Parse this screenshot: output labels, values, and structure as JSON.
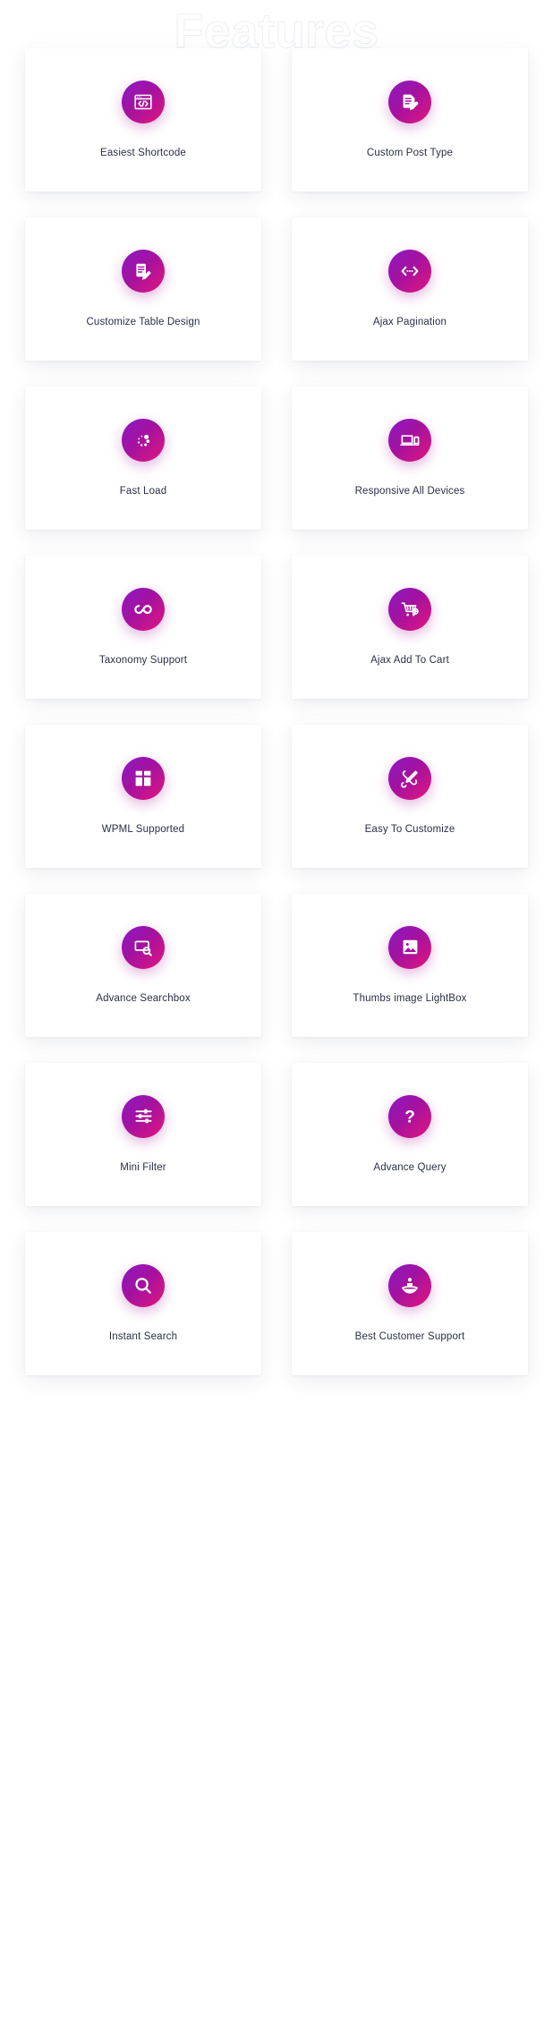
{
  "section": {
    "title": "Features",
    "title_style": "outlined-ghost",
    "outline_color": "#eceef1"
  },
  "theme": {
    "page_background": "#ffffff",
    "card_background": "#ffffff",
    "label_color": "#2b2f45",
    "icon_gradient_start": "#8b18c4",
    "icon_gradient_mid": "#a3129f",
    "icon_gradient_end": "#e3157e"
  },
  "cards": [
    {
      "label": "Easiest Shortcode",
      "icon": "code-window-icon"
    },
    {
      "label": "Custom Post Type",
      "icon": "document-pencil-icon"
    },
    {
      "label": "Customize Table Design",
      "icon": "table-edit-icon"
    },
    {
      "label": "Ajax Pagination",
      "icon": "pagination-arrows-icon"
    },
    {
      "label": "Fast Load",
      "icon": "spinner-dots-icon"
    },
    {
      "label": "Responsive All Devices",
      "icon": "laptop-phone-icon"
    },
    {
      "label": "Taxonomy Support",
      "icon": "infinity-icon"
    },
    {
      "label": "Ajax Add To Cart",
      "icon": "cart-plus-icon"
    },
    {
      "label": "WPML Supported",
      "icon": "grid-blocks-icon"
    },
    {
      "label": "Easy To Customize",
      "icon": "wrench-pencil-icon"
    },
    {
      "label": "Advance Searchbox",
      "icon": "searchbox-icon"
    },
    {
      "label": "Thumbs image LightBox",
      "icon": "image-photo-icon"
    },
    {
      "label": "Mini Filter",
      "icon": "sliders-filter-icon"
    },
    {
      "label": "Advance Query",
      "icon": "question-mark-icon"
    },
    {
      "label": "Instant Search",
      "icon": "magnifier-icon"
    },
    {
      "label": "Best Customer Support",
      "icon": "support-hand-icon"
    }
  ]
}
